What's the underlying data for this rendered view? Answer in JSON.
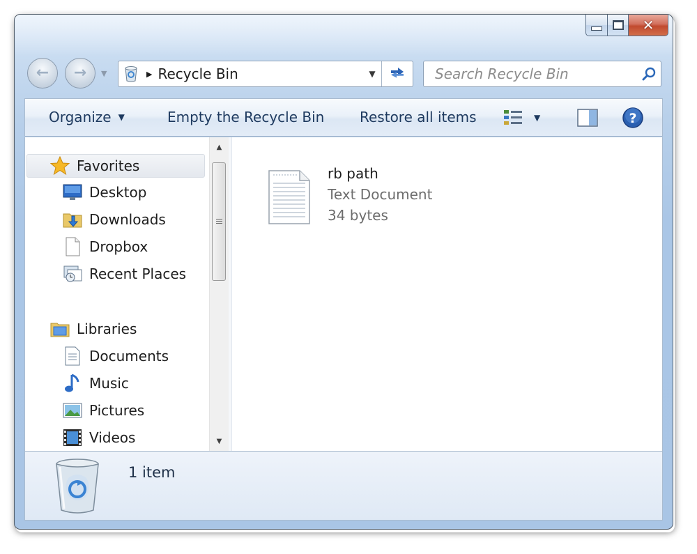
{
  "window": {
    "title": "Recycle Bin"
  },
  "caption_buttons": {
    "close_glyph": "✕"
  },
  "address_bar": {
    "location": "Recycle Bin",
    "separator": "▶"
  },
  "search": {
    "placeholder": "Search Recycle Bin"
  },
  "toolbar": {
    "organize_label": "Organize",
    "empty_label": "Empty the Recycle Bin",
    "restore_label": "Restore all items"
  },
  "nav_pane": {
    "favorites": {
      "label": "Favorites",
      "items": [
        {
          "label": "Desktop",
          "icon": "desktop-icon"
        },
        {
          "label": "Downloads",
          "icon": "downloads-icon"
        },
        {
          "label": "Dropbox",
          "icon": "dropbox-icon"
        },
        {
          "label": "Recent Places",
          "icon": "recent-places-icon"
        }
      ]
    },
    "libraries": {
      "label": "Libraries",
      "items": [
        {
          "label": "Documents",
          "icon": "documents-icon"
        },
        {
          "label": "Music",
          "icon": "music-icon"
        },
        {
          "label": "Pictures",
          "icon": "pictures-icon"
        },
        {
          "label": "Videos",
          "icon": "videos-icon"
        }
      ]
    }
  },
  "content": {
    "files": [
      {
        "name": "rb path",
        "type": "Text Document",
        "size": "34 bytes",
        "icon": "text-document-icon"
      }
    ]
  },
  "details_pane": {
    "count": "1 item",
    "icon": "recycle-bin-icon"
  },
  "colors": {
    "accent": "#2c63b5",
    "link_text": "#1e3a5f",
    "close_red": "#c14a2f"
  }
}
